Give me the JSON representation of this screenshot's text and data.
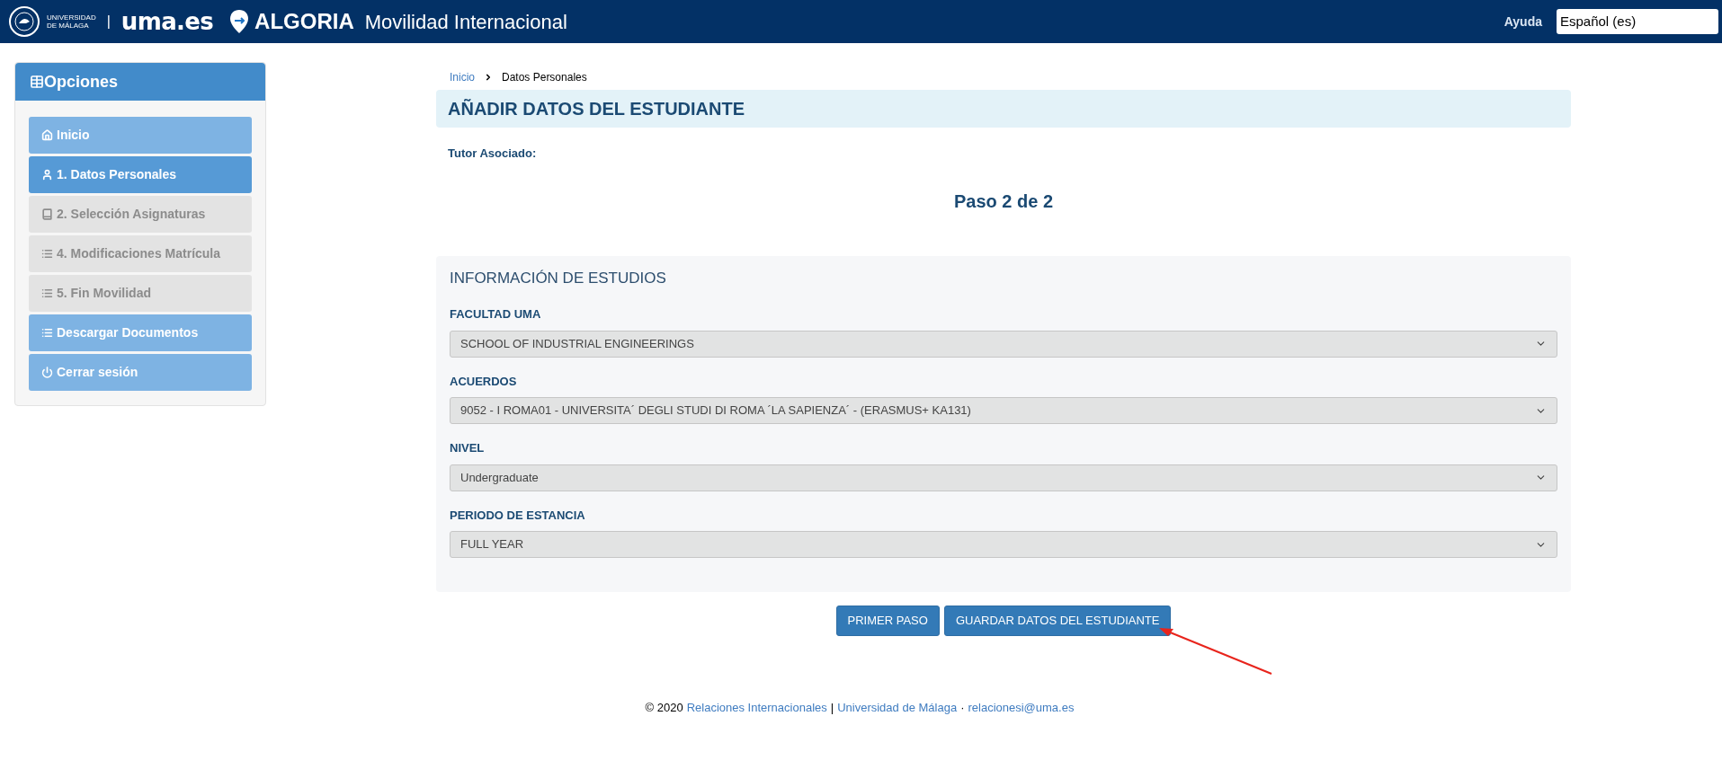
{
  "header": {
    "university": [
      "UNIVERSIDAD",
      "DE MÁLAGA"
    ],
    "separator": "|",
    "site": "uma.es",
    "brand": "ALGORIA",
    "title": "Movilidad Internacional",
    "help": "Ayuda",
    "language": "Español (es)"
  },
  "sidebar": {
    "title": "Opciones",
    "items": [
      {
        "label": "Inicio",
        "selected": false,
        "disabled": false
      },
      {
        "label": "1. Datos Personales",
        "selected": true,
        "disabled": false
      },
      {
        "label": "2. Selección Asignaturas",
        "selected": false,
        "disabled": true
      },
      {
        "label": "4. Modificaciones Matrícula",
        "selected": false,
        "disabled": true
      },
      {
        "label": "5. Fin Movilidad",
        "selected": false,
        "disabled": true
      },
      {
        "label": "Descargar Documentos",
        "selected": false,
        "disabled": false
      },
      {
        "label": "Cerrar sesión",
        "selected": false,
        "disabled": false
      }
    ]
  },
  "breadcrumb": [
    {
      "label": "Inicio",
      "kind": "link"
    },
    {
      "label": "Datos Personales",
      "kind": "current"
    }
  ],
  "page_title": "AÑADIR DATOS DEL ESTUDIANTE",
  "tutor_label": "Tutor Asociado:",
  "step": "Paso 2 de 2",
  "panel": {
    "title": "INFORMACIÓN DE ESTUDIOS",
    "fields": [
      {
        "label": "FACULTAD UMA",
        "value": "SCHOOL OF INDUSTRIAL ENGINEERINGS"
      },
      {
        "label": "ACUERDOS",
        "value": "9052 - I ROMA01 - UNIVERSITA´ DEGLI STUDI DI ROMA ´LA SAPIENZA´ - (ERASMUS+ KA131)"
      },
      {
        "label": "NIVEL",
        "value": "Undergraduate"
      },
      {
        "label": "PERIODO DE ESTANCIA",
        "value": "FULL YEAR"
      }
    ]
  },
  "buttons": [
    "PRIMER PASO",
    "GUARDAR DATOS DEL ESTUDIANTE"
  ],
  "footer": [
    {
      "text": "© 2020",
      "kind": "text"
    },
    {
      "text": "Relaciones Internacionales",
      "kind": "link"
    },
    {
      "text": "|",
      "kind": "text"
    },
    {
      "text": "Universidad de Málaga",
      "kind": "link"
    },
    {
      "text": "·",
      "kind": "text"
    },
    {
      "text": "relacionesi@uma.es",
      "kind": "link"
    }
  ]
}
